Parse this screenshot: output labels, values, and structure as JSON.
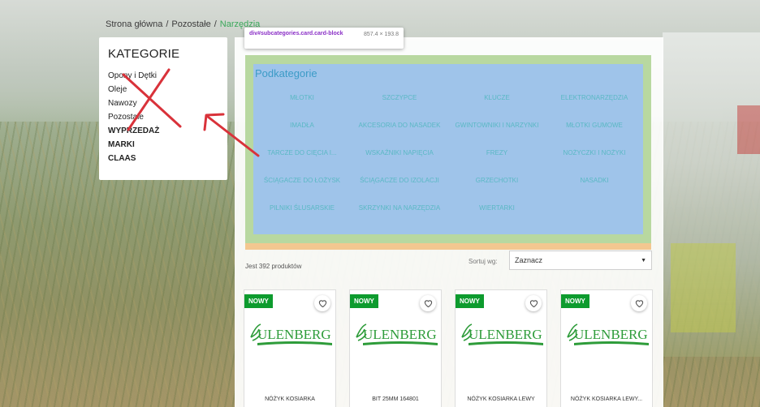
{
  "breadcrumb": {
    "home": "Strona główna",
    "parent": "Pozostałe",
    "current": "Narzędzia"
  },
  "categories": {
    "title": "KATEGORIE",
    "items": [
      {
        "label": "Opony i Dętki",
        "bold": false
      },
      {
        "label": "Oleje",
        "bold": false
      },
      {
        "label": "Nawozy",
        "bold": false
      },
      {
        "label": "Pozostałe",
        "bold": false
      },
      {
        "label": "WYPRZEDAŻ",
        "bold": true
      },
      {
        "label": "MARKI",
        "bold": true
      },
      {
        "label": "CLAAS",
        "bold": true
      }
    ]
  },
  "devtools": {
    "selector": "div#subcategories.card.card-block",
    "dimensions": "857.4 × 193.8"
  },
  "subcategories": {
    "title": "Podkategorie",
    "items": [
      "MŁOTKI",
      "SZCZYPCE",
      "KLUCZE",
      "ELEKTRONARZĘDZIA",
      "IMADŁA",
      "AKCESORIA DO NASADEK",
      "GWINTOWNIKI I NARZYNKI",
      "MŁOTKI GUMOWE",
      "TARCZE DO CIĘCIA I...",
      "WSKAŹNIKI NAPIĘCIA",
      "FREZY",
      "NOŻYCZKI I NOŻYKI",
      "ŚCIĄGACZE DO ŁOŻYSK",
      "ŚCIĄGACZE DO IZOLACJI",
      "GRZECHOTKI",
      "NASADKI",
      "PILNIKI ŚLUSARSKIE",
      "SKRZYNKI NA NARZĘDZIA",
      "WIERTARKI"
    ]
  },
  "listing": {
    "count_text": "Jest 392 produktów",
    "sort_label": "Sortuj wg:",
    "sort_value": "Zaznacz"
  },
  "products": [
    {
      "badge": "NOWY",
      "brand": "ULENBERG",
      "name": "NÓŻYK KOSIARKA"
    },
    {
      "badge": "NOWY",
      "brand": "ULENBERG",
      "name": "BIT 25MM 164801"
    },
    {
      "badge": "NOWY",
      "brand": "ULENBERG",
      "name": "NÓŻYK KOSIARKA LEWY"
    },
    {
      "badge": "NOWY",
      "brand": "ULENBERG",
      "name": "NÓŻYK KOSIARKA LEWY..."
    }
  ],
  "colors": {
    "accent_green": "#0d9b2e",
    "breadcrumb_current": "#3aa85a",
    "annotation_red": "#d9323a",
    "devtools_margin": "#f3c790",
    "devtools_padding": "#b8d8a0",
    "devtools_content": "#9fc4ea"
  }
}
